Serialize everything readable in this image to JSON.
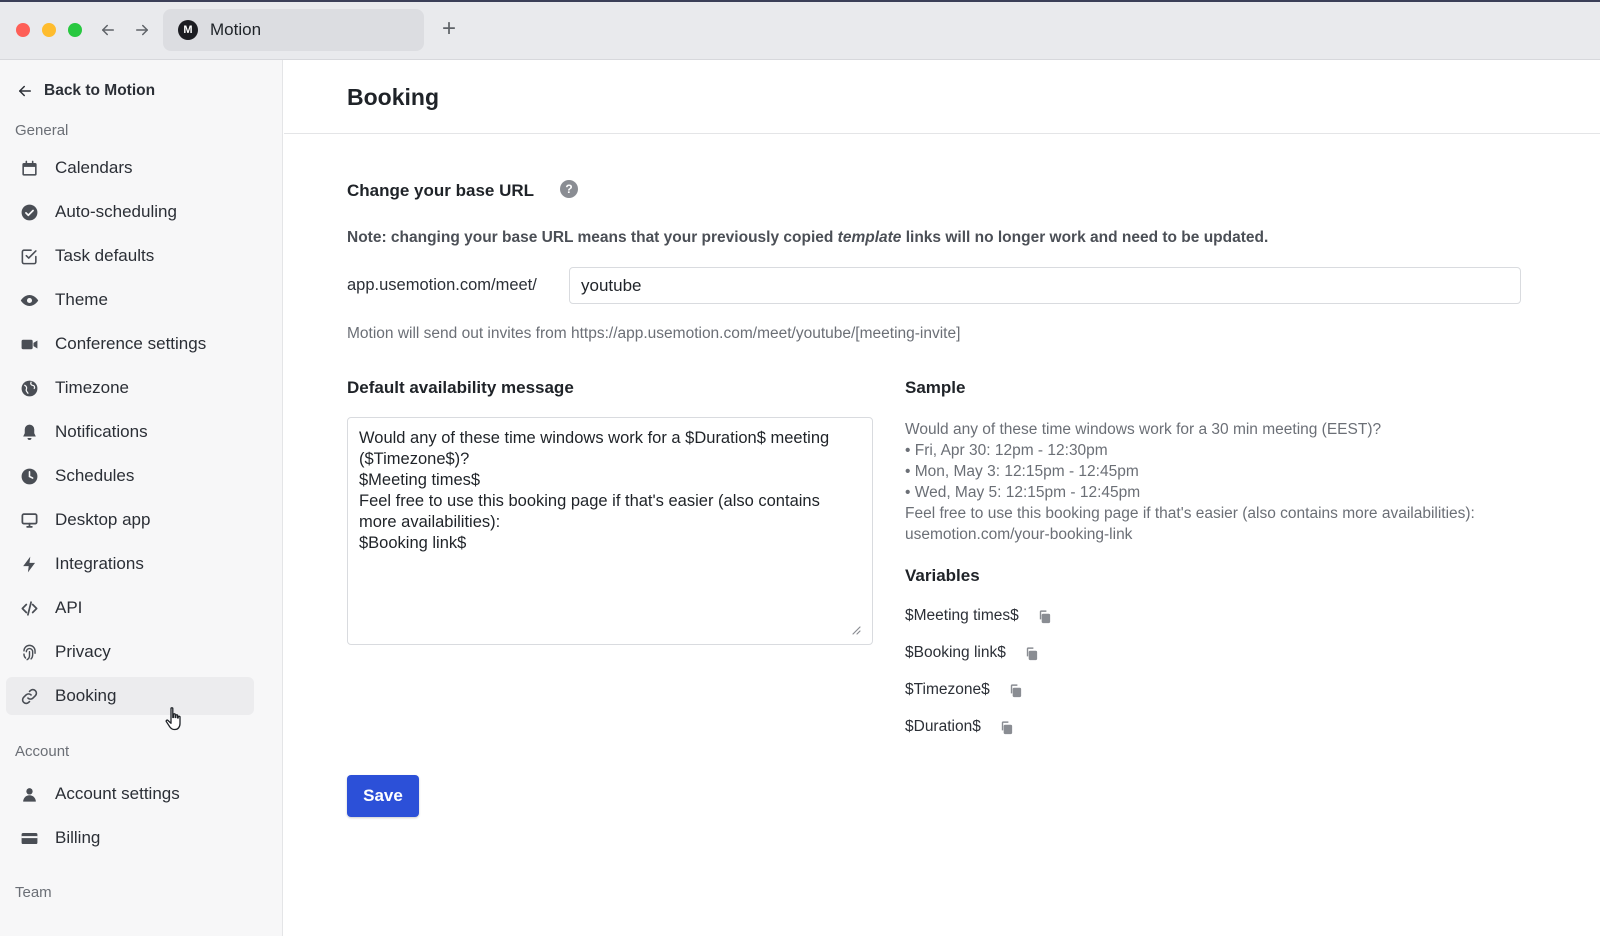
{
  "browser": {
    "tab_title": "Motion",
    "tab_favicon": "M",
    "new_tab": "+"
  },
  "sidebar": {
    "back_label": "Back to Motion",
    "sections": {
      "general": "General",
      "account": "Account",
      "team": "Team"
    },
    "items": [
      {
        "label": "Calendars",
        "icon": "calendar-icon"
      },
      {
        "label": "Auto-scheduling",
        "icon": "check-circle-icon"
      },
      {
        "label": "Task defaults",
        "icon": "checkbox-icon"
      },
      {
        "label": "Theme",
        "icon": "eye-icon"
      },
      {
        "label": "Conference settings",
        "icon": "video-camera-icon"
      },
      {
        "label": "Timezone",
        "icon": "globe-icon"
      },
      {
        "label": "Notifications",
        "icon": "bell-icon"
      },
      {
        "label": "Schedules",
        "icon": "clock-icon"
      },
      {
        "label": "Desktop app",
        "icon": "monitor-icon"
      },
      {
        "label": "Integrations",
        "icon": "lightning-icon"
      },
      {
        "label": "API",
        "icon": "code-icon"
      },
      {
        "label": "Privacy",
        "icon": "fingerprint-icon"
      },
      {
        "label": "Booking",
        "icon": "link-icon",
        "active": true
      }
    ],
    "account_items": [
      {
        "label": "Account settings",
        "icon": "user-icon"
      },
      {
        "label": "Billing",
        "icon": "credit-card-icon"
      }
    ]
  },
  "page": {
    "title": "Booking",
    "base_url": {
      "heading": "Change your base URL",
      "note_before": "Note: changing your base URL means that your previously copied ",
      "note_em": "template",
      "note_after": " links will no longer work and need to be updated.",
      "prefix": "app.usemotion.com/meet/",
      "value": "youtube",
      "invite_text": "Motion will send out invites from https://app.usemotion.com/meet/youtube/[meeting-invite]"
    },
    "availability": {
      "heading": "Default availability message",
      "message": "Would any of these time windows work for a $Duration$ meeting ($Timezone$)?\n$Meeting times$\nFeel free to use this booking page if that's easier (also contains more availabilities):\n$Booking link$"
    },
    "sample": {
      "heading": "Sample",
      "lines": [
        "Would any of these time windows work for a 30 min meeting (EEST)?",
        "• Fri, Apr 30: 12pm - 12:30pm",
        "• Mon, May 3: 12:15pm - 12:45pm",
        "• Wed, May 5: 12:15pm - 12:45pm",
        "Feel free to use this booking page if that's easier (also contains more availabilities):",
        "usemotion.com/your-booking-link"
      ]
    },
    "variables": {
      "heading": "Variables",
      "items": [
        "$Meeting times$",
        "$Booking link$",
        "$Timezone$",
        "$Duration$"
      ]
    },
    "save_label": "Save"
  },
  "colors": {
    "accent": "#2c50d8",
    "sidebar_bg": "#f7f7f8",
    "active_item_bg": "#ececee"
  }
}
